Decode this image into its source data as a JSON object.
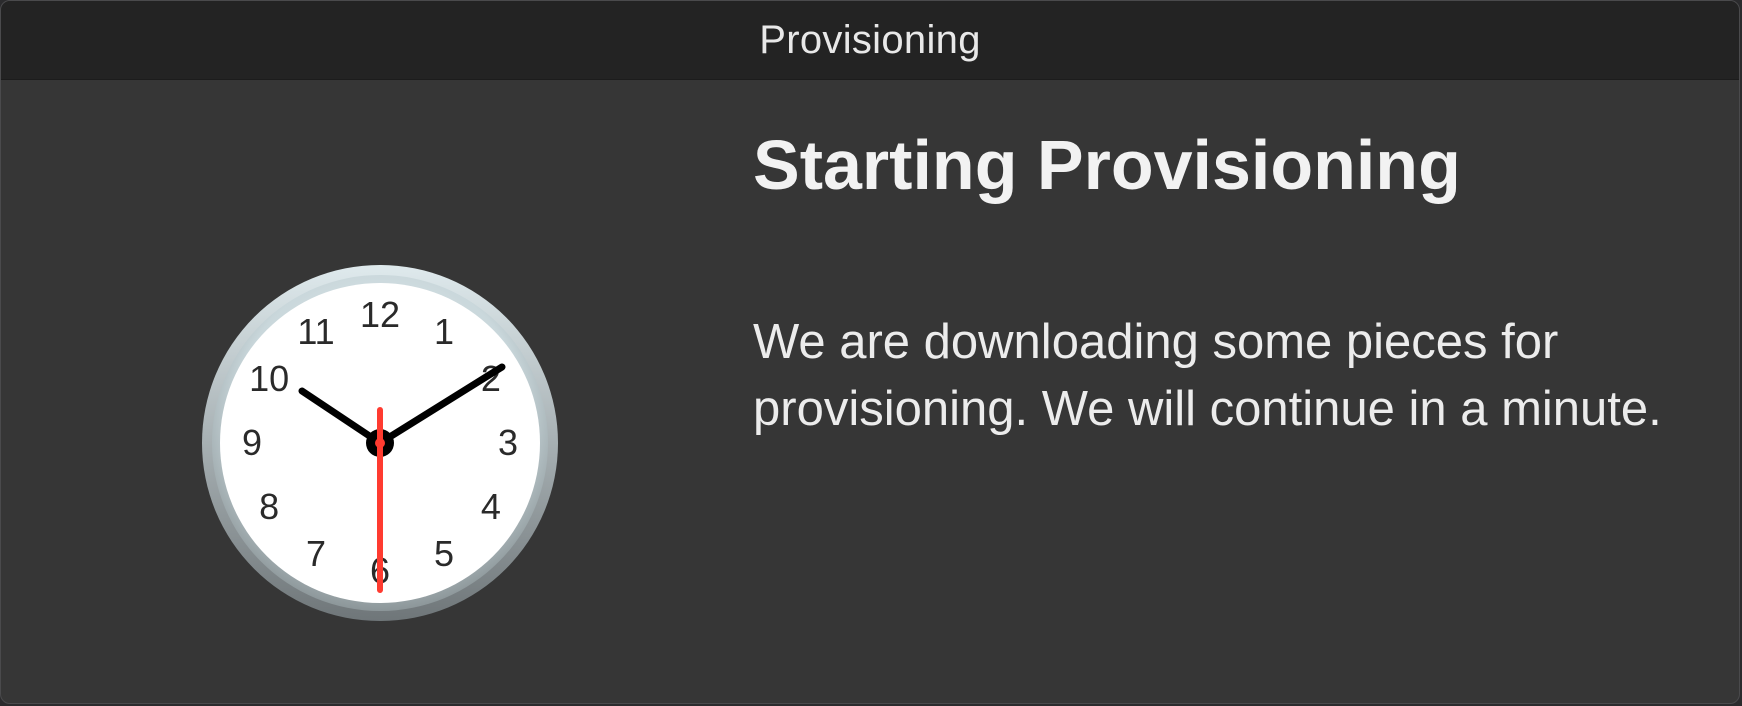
{
  "window": {
    "title": "Provisioning"
  },
  "dialog": {
    "heading": "Starting Provisioning",
    "message": "We are downloading some pieces for provisioning. We will continue in a minute."
  },
  "clock": {
    "icon": "clock-icon",
    "numerals": [
      "12",
      "1",
      "2",
      "3",
      "4",
      "5",
      "6",
      "7",
      "8",
      "9",
      "10",
      "11"
    ]
  },
  "colors": {
    "window_bg": "#363636",
    "titlebar_bg": "#232323",
    "second_hand": "#ff3b30"
  }
}
